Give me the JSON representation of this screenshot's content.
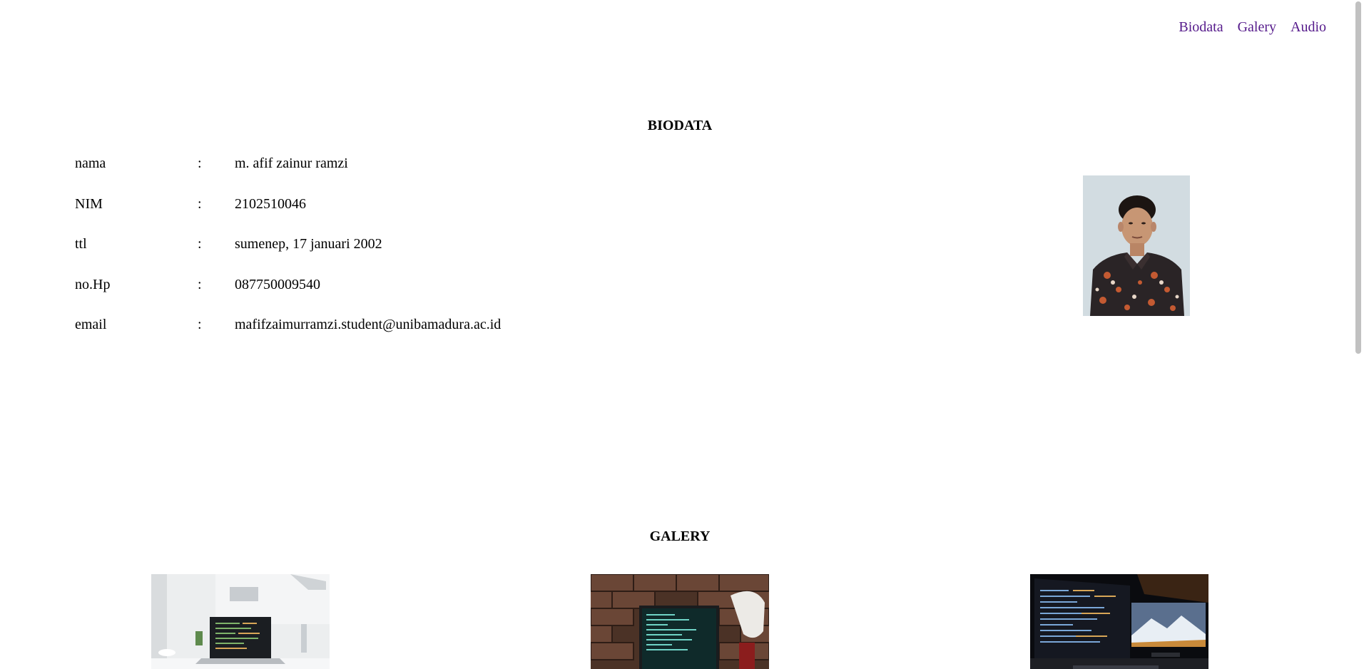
{
  "nav": {
    "items": [
      "Biodata",
      "Galery",
      "Audio"
    ]
  },
  "biodata": {
    "title": "BIODATA",
    "separator": ":",
    "rows": [
      {
        "label": "nama",
        "value": "m. afif zainur ramzi"
      },
      {
        "label": "NIM",
        "value": "2102510046"
      },
      {
        "label": "ttl",
        "value": "sumenep, 17 januari 2002"
      },
      {
        "label": "no.Hp",
        "value": "087750009540"
      },
      {
        "label": "email",
        "value": "mafifzaimurramzi.student@unibamadura.ac.id"
      }
    ]
  },
  "gallery": {
    "title": "GALERY"
  },
  "colors": {
    "link": "#551a8b",
    "background": "#ffffff",
    "text": "#000000"
  }
}
